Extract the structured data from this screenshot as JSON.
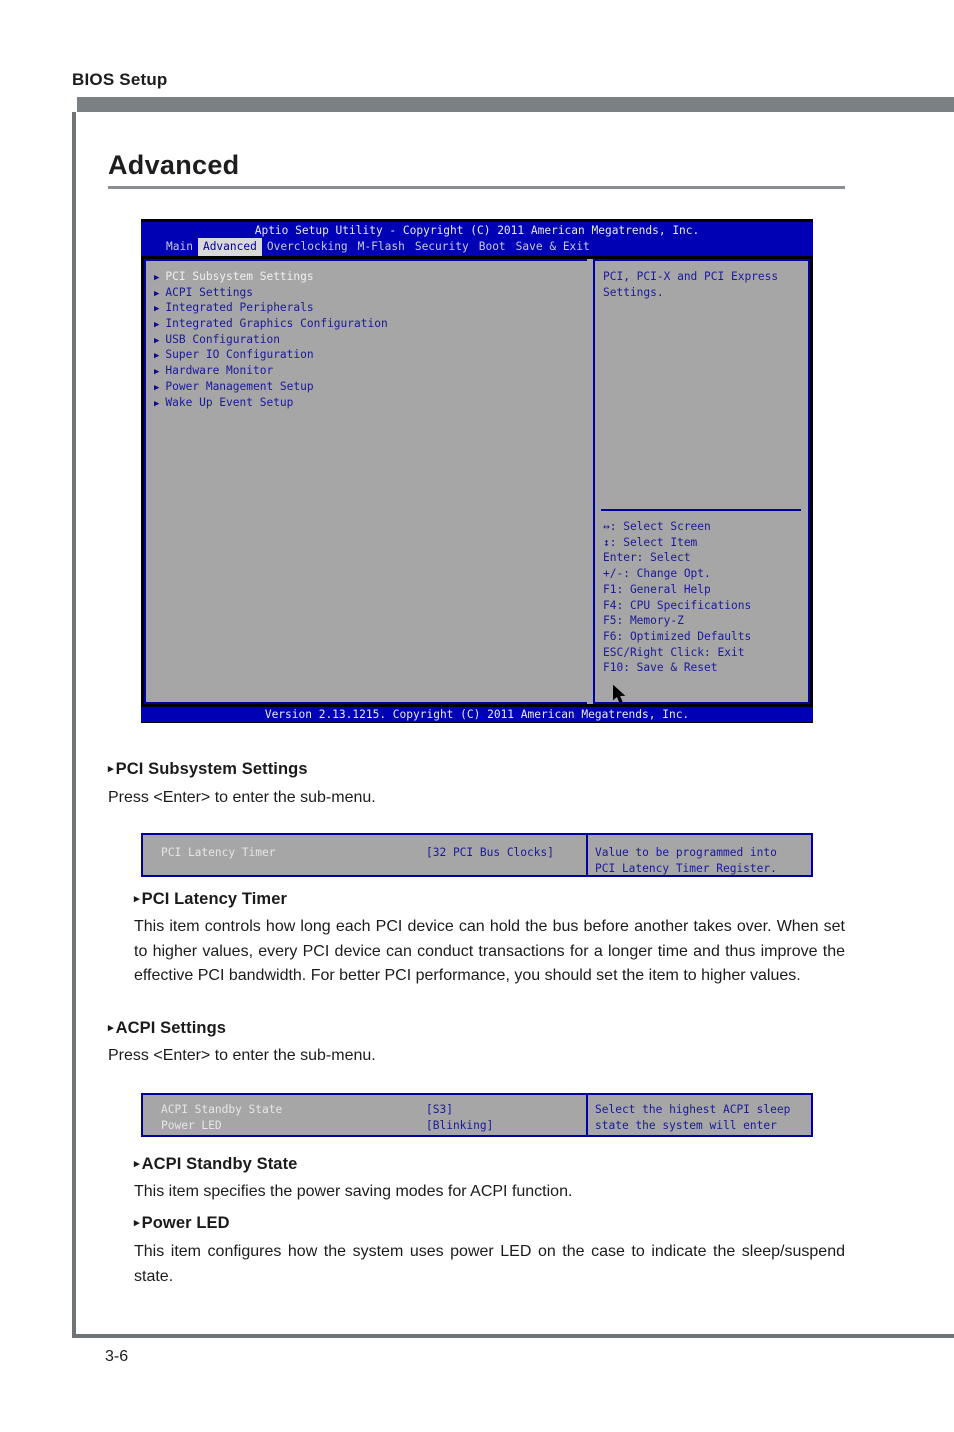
{
  "page": {
    "running_head": "BIOS Setup",
    "section_title": "Advanced",
    "page_number": "3-6"
  },
  "bios_main": {
    "title": "Aptio Setup Utility - Copyright (C) 2011 American Megatrends, Inc.",
    "tabs": [
      {
        "label": "Main",
        "active": false
      },
      {
        "label": "Advanced",
        "active": true
      },
      {
        "label": "Overclocking",
        "active": false
      },
      {
        "label": "M-Flash",
        "active": false
      },
      {
        "label": "Security",
        "active": false
      },
      {
        "label": "Boot",
        "active": false
      },
      {
        "label": "Save & Exit",
        "active": false
      }
    ],
    "menu_items": [
      {
        "label": "PCI Subsystem Settings",
        "selected": true
      },
      {
        "label": "ACPI Settings",
        "selected": false
      },
      {
        "label": "Integrated Peripherals",
        "selected": false
      },
      {
        "label": "Integrated Graphics Configuration",
        "selected": false
      },
      {
        "label": "USB Configuration",
        "selected": false
      },
      {
        "label": "Super IO Configuration",
        "selected": false
      },
      {
        "label": "Hardware Monitor",
        "selected": false
      },
      {
        "label": "Power Management Setup",
        "selected": false
      },
      {
        "label": "Wake Up Event Setup",
        "selected": false
      }
    ],
    "help_text": "PCI, PCI-X and PCI Express\nSettings.",
    "keys": "↔: Select Screen\n↕: Select Item\nEnter: Select\n+/-: Change Opt.\nF1: General Help\nF4: CPU Specifications\nF5: Memory-Z\nF6: Optimized Defaults\nESC/Right Click: Exit\nF10: Save & Reset",
    "footer": "Version 2.13.1215. Copyright (C) 2011 American Megatrends, Inc.",
    "colors": {
      "bar_blue": "#0000b4",
      "panel_gray": "#a6a6a6",
      "border_blue": "#0000a0",
      "text_blue": "#19199c"
    }
  },
  "strip_pci": {
    "rows": [
      {
        "name": "PCI Latency Timer",
        "value": "[32 PCI Bus Clocks]"
      }
    ],
    "help_text": "Value to be programmed into\nPCI Latency Timer Register."
  },
  "strip_acpi": {
    "rows": [
      {
        "name": "ACPI Standby State",
        "value": "[S3]"
      },
      {
        "name": "Power LED",
        "value": "[Blinking]"
      }
    ],
    "help_text": "Select the highest ACPI sleep\nstate the system will enter"
  },
  "sections": [
    {
      "heading": "PCI Subsystem Settings",
      "body": "Press <Enter> to enter the sub-menu."
    },
    {
      "heading": "PCI Latency Timer",
      "body": "This item controls how long each PCI device can hold the bus before another takes over. When set to higher values, every PCI device can conduct transactions for a longer time and thus improve the effective PCI bandwidth. For better PCI performance, you should set the item to higher values."
    },
    {
      "heading": "ACPI Settings",
      "body": "Press <Enter> to enter the sub-menu."
    },
    {
      "heading": "ACPI Standby State",
      "body": "This item specifies the power saving modes for ACPI function."
    },
    {
      "heading": "Power LED",
      "body": "This item configures how the system uses power LED on the case to indicate the sleep/suspend state."
    }
  ],
  "icons": {
    "triangle_bullet": "▸",
    "menu_arrow": "▶",
    "cursor": "mouse-pointer"
  }
}
